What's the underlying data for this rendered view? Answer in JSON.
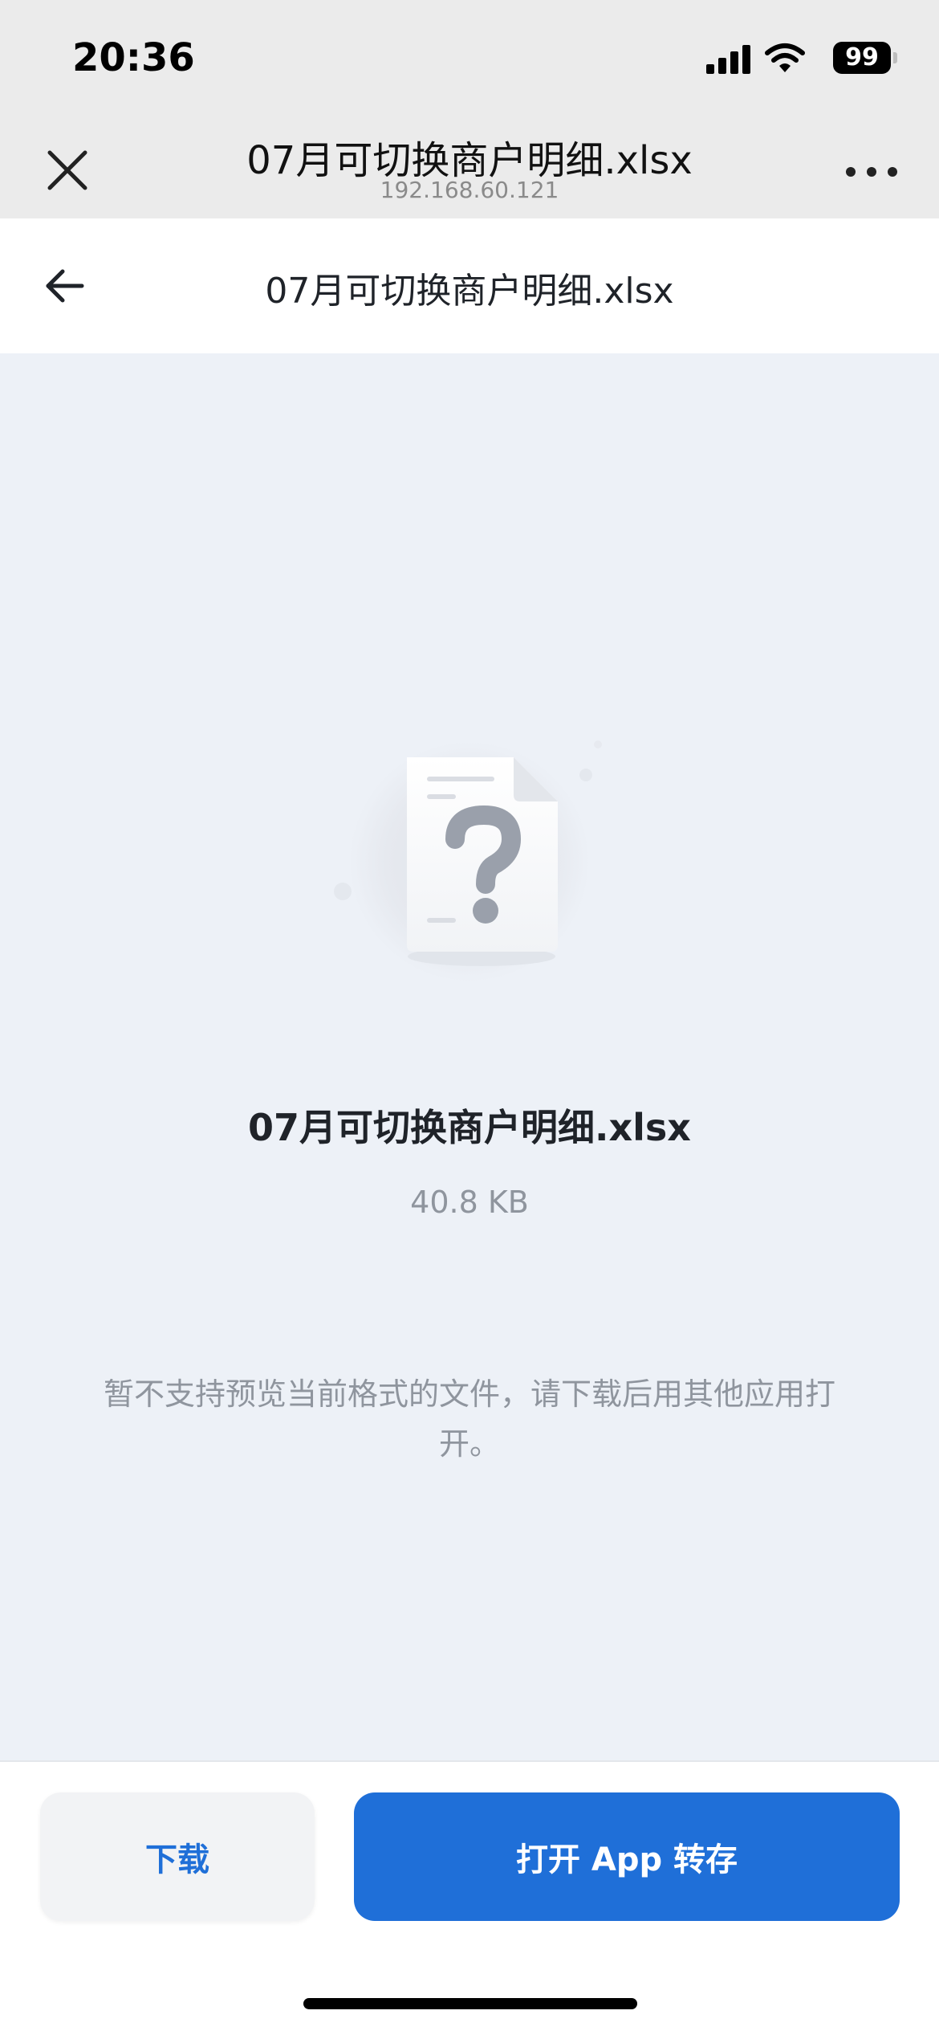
{
  "status_bar": {
    "time": "20:36",
    "battery": "99",
    "icons": [
      "cellular-signal-icon",
      "wifi-icon",
      "battery-icon"
    ]
  },
  "browser_bar": {
    "title": "07月可切换商户明细.xlsx",
    "url": "192.168.60.121",
    "icons": [
      "close-icon",
      "more-icon"
    ]
  },
  "nav_bar": {
    "title": "07月可切换商户明细.xlsx",
    "icons": [
      "back-arrow-icon"
    ]
  },
  "preview": {
    "icon": "unknown-file-icon",
    "file_name": "07月可切换商户明细.xlsx",
    "file_size": "40.8 KB",
    "notice": "暂不支持预览当前格式的文件，请下载后用其他应用打开。"
  },
  "actions": {
    "download_label": "下载",
    "open_app_label": "打开 App 转存"
  },
  "colors": {
    "accent": "#1f6fd8",
    "page_background": "#edf1f7",
    "browser_bar": "#ebebeb",
    "muted_text": "#8f959e"
  }
}
